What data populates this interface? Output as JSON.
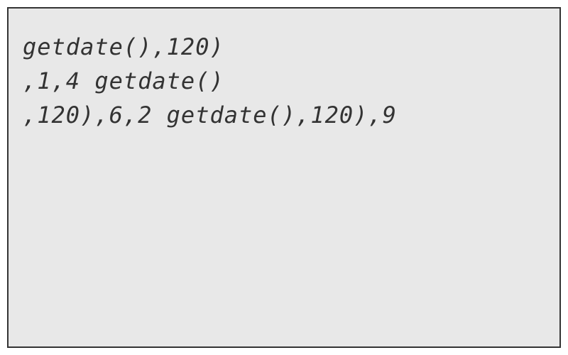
{
  "lines": [
    "getdate(),120)",
    ",1,4 getdate()",
    ",120),6,2 getdate(),120),9"
  ]
}
